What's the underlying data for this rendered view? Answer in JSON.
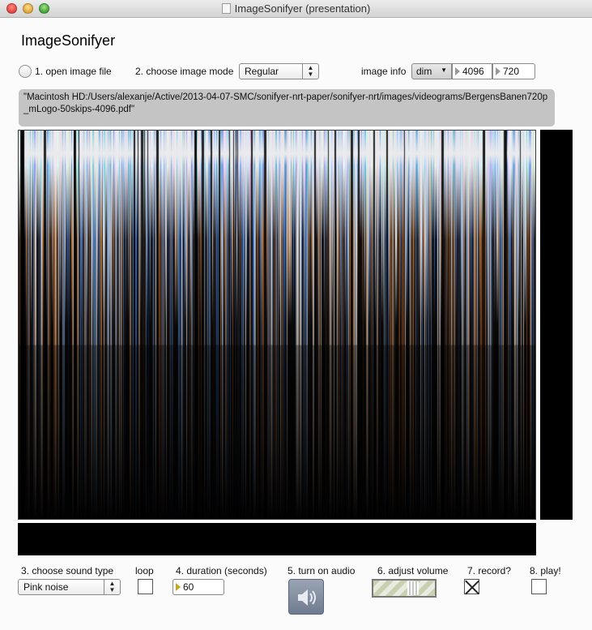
{
  "window": {
    "title": "ImageSonifyer (presentation)"
  },
  "app": {
    "title": "ImageSonifyer"
  },
  "controls": {
    "open_image_label": "1. open image file",
    "image_mode_label": "2. choose image mode",
    "image_mode_value": "Regular",
    "image_info_label": "image info",
    "dim_menu_value": "dim",
    "dim_width": "4096",
    "dim_height": "720",
    "file_path": "\"Macintosh HD:/Users/alexanje/Active/2013-04-07-SMC/sonifyer-nrt-paper/sonifyer-nrt/images/videograms/BergensBanen720p_mLogo-50skips-4096.pdf\"",
    "sound_type_label": "3. choose sound type",
    "sound_type_value": "Pink noise",
    "loop_label": "loop",
    "loop_checked": false,
    "duration_label": "4. duration (seconds)",
    "duration_value": "60",
    "audio_label": "5. turn on audio",
    "volume_label": "6. adjust volume",
    "volume_level": 0.68,
    "record_label": "7. record?",
    "record_checked": true,
    "play_label": "8. play!",
    "play_checked": false
  },
  "icons": {
    "stepper": "up-down-arrows-icon",
    "audio": "speaker-icon",
    "dropdown": "triangle-down-icon"
  }
}
